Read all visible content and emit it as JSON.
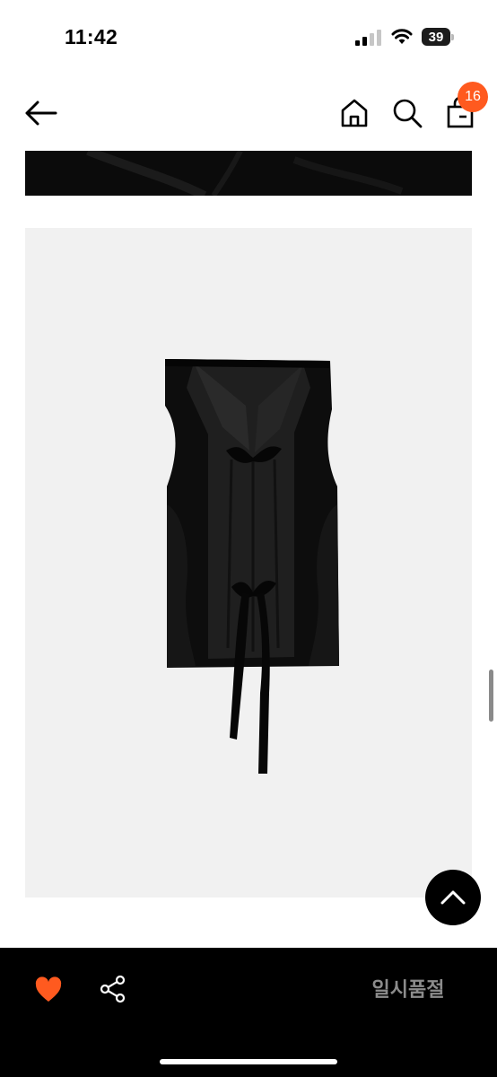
{
  "status_bar": {
    "time": "11:42",
    "battery_level": "39",
    "icons": [
      "signal-icon",
      "wifi-icon",
      "battery-icon"
    ]
  },
  "nav": {
    "icons": [
      "back-arrow-icon",
      "home-icon",
      "search-icon",
      "shopping-bag-icon"
    ],
    "cart_count": "16"
  },
  "product": {
    "image_icon": "garment-photo"
  },
  "bottom_bar": {
    "like_icon": "heart-icon",
    "share_icon": "share-icon",
    "status_label": "일시품절"
  },
  "colors": {
    "accent": "#ff5a1f",
    "bottom_bar_bg": "#000000",
    "image_bg": "#f1f1f1",
    "soldout_text": "#8c8c8c"
  }
}
